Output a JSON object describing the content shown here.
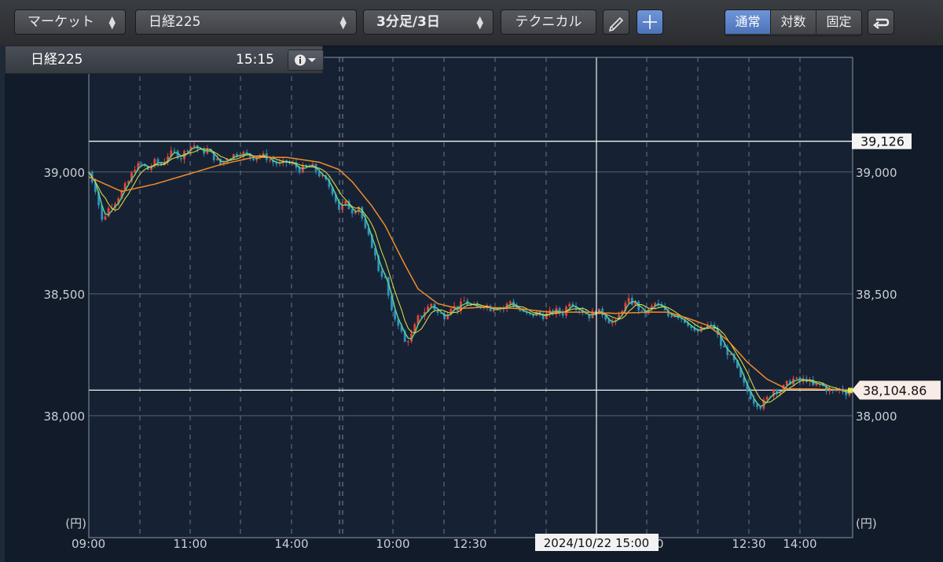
{
  "toolbar": {
    "market_label": "マーケット",
    "symbol_label": "日経225",
    "period_label": "3分足/3日",
    "technical_label": "テクニカル",
    "scale_options": [
      "通常",
      "対数",
      "固定"
    ],
    "active_scale": "通常",
    "pen_icon": "pencil-icon",
    "crosshair_icon": "plus-icon",
    "undo_icon": "return-arrow-icon"
  },
  "info": {
    "symbol": "日経225",
    "time": "15:15",
    "menu_icon": "info-icon"
  },
  "colors": {
    "background": "#121b29",
    "grid": "#5f6a78",
    "up_candle": "#e8443a",
    "down_candle": "#2f8fc2",
    "ma_short": "#5ad08c",
    "ma_mid": "#e9e34a",
    "ma_long": "#f08c2c",
    "active_button": "#5a82c8"
  },
  "chart_data": {
    "type": "candlestick",
    "unit_label": "(円)",
    "y_ticks": [
      "39,000",
      "38,500",
      "38,000"
    ],
    "ylim": [
      37500,
      39470
    ],
    "x_ticks": [
      "09:00",
      "11:00",
      "14:00",
      "10:00",
      "12:30",
      "15:00",
      "12:30",
      "14:00"
    ],
    "crosshair_label": "2024/10/22 15:00",
    "horizontal_lines": [
      {
        "value": 39126,
        "label": "39,126"
      },
      {
        "value": 38104.86,
        "label": "38,104.86"
      }
    ],
    "price_path": [
      [
        0,
        39000
      ],
      [
        2,
        38930
      ],
      [
        4,
        38800
      ],
      [
        6,
        38850
      ],
      [
        8,
        38880
      ],
      [
        10,
        38920
      ],
      [
        12,
        38960
      ],
      [
        14,
        39020
      ],
      [
        16,
        39030
      ],
      [
        18,
        39010
      ],
      [
        20,
        39040
      ],
      [
        22,
        39030
      ],
      [
        24,
        39070
      ],
      [
        26,
        39080
      ],
      [
        28,
        39060
      ],
      [
        30,
        39100
      ],
      [
        32,
        39110
      ],
      [
        34,
        39080
      ],
      [
        36,
        39090
      ],
      [
        38,
        39060
      ],
      [
        40,
        39030
      ],
      [
        42,
        39060
      ],
      [
        44,
        39070
      ],
      [
        46,
        39080
      ],
      [
        48,
        39070
      ],
      [
        50,
        39060
      ],
      [
        52,
        39070
      ],
      [
        54,
        39060
      ],
      [
        56,
        39040
      ],
      [
        58,
        39030
      ],
      [
        60,
        39040
      ],
      [
        62,
        39030
      ],
      [
        64,
        39010
      ],
      [
        66,
        39020
      ],
      [
        68,
        39020
      ],
      [
        70,
        38990
      ],
      [
        72,
        38960
      ],
      [
        74,
        38920
      ],
      [
        76,
        38850
      ],
      [
        78,
        38870
      ],
      [
        80,
        38840
      ],
      [
        82,
        38860
      ],
      [
        84,
        38760
      ],
      [
        86,
        38700
      ],
      [
        88,
        38600
      ],
      [
        90,
        38560
      ],
      [
        92,
        38420
      ],
      [
        94,
        38380
      ],
      [
        96,
        38300
      ],
      [
        98,
        38330
      ],
      [
        100,
        38400
      ],
      [
        102,
        38430
      ],
      [
        104,
        38460
      ],
      [
        106,
        38420
      ],
      [
        108,
        38410
      ],
      [
        110,
        38450
      ],
      [
        112,
        38440
      ],
      [
        114,
        38470
      ],
      [
        116,
        38450
      ],
      [
        118,
        38440
      ],
      [
        120,
        38460
      ],
      [
        122,
        38440
      ],
      [
        124,
        38450
      ],
      [
        126,
        38440
      ],
      [
        128,
        38470
      ],
      [
        130,
        38440
      ],
      [
        132,
        38420
      ],
      [
        134,
        38410
      ],
      [
        136,
        38420
      ],
      [
        138,
        38410
      ],
      [
        140,
        38420
      ],
      [
        142,
        38430
      ],
      [
        144,
        38420
      ],
      [
        146,
        38470
      ],
      [
        148,
        38450
      ],
      [
        150,
        38430
      ],
      [
        152,
        38410
      ],
      [
        154,
        38430
      ],
      [
        156,
        38420
      ],
      [
        158,
        38390
      ],
      [
        160,
        38380
      ],
      [
        162,
        38440
      ],
      [
        164,
        38470
      ],
      [
        166,
        38460
      ],
      [
        168,
        38420
      ],
      [
        170,
        38430
      ],
      [
        172,
        38460
      ],
      [
        174,
        38440
      ],
      [
        176,
        38410
      ],
      [
        178,
        38420
      ],
      [
        180,
        38400
      ],
      [
        182,
        38380
      ],
      [
        184,
        38340
      ],
      [
        186,
        38350
      ],
      [
        188,
        38370
      ],
      [
        190,
        38360
      ],
      [
        192,
        38290
      ],
      [
        194,
        38260
      ],
      [
        196,
        38220
      ],
      [
        198,
        38150
      ],
      [
        200,
        38100
      ],
      [
        202,
        38060
      ],
      [
        204,
        38040
      ],
      [
        206,
        38070
      ],
      [
        208,
        38110
      ],
      [
        210,
        38100
      ],
      [
        212,
        38130
      ],
      [
        214,
        38150
      ],
      [
        216,
        38140
      ],
      [
        218,
        38150
      ],
      [
        220,
        38120
      ],
      [
        222,
        38130
      ],
      [
        224,
        38110
      ],
      [
        226,
        38100
      ],
      [
        228,
        38110
      ],
      [
        230,
        38095
      ],
      [
        232,
        38105
      ]
    ],
    "ma_long_path": [
      [
        0,
        38980
      ],
      [
        10,
        38920
      ],
      [
        20,
        38950
      ],
      [
        30,
        38990
      ],
      [
        40,
        39030
      ],
      [
        50,
        39060
      ],
      [
        60,
        39060
      ],
      [
        70,
        39040
      ],
      [
        76,
        39010
      ],
      [
        80,
        38960
      ],
      [
        86,
        38860
      ],
      [
        90,
        38780
      ],
      [
        96,
        38620
      ],
      [
        100,
        38520
      ],
      [
        106,
        38460
      ],
      [
        112,
        38440
      ],
      [
        120,
        38445
      ],
      [
        130,
        38440
      ],
      [
        140,
        38425
      ],
      [
        150,
        38425
      ],
      [
        160,
        38420
      ],
      [
        170,
        38425
      ],
      [
        176,
        38425
      ],
      [
        182,
        38400
      ],
      [
        188,
        38370
      ],
      [
        194,
        38310
      ],
      [
        200,
        38220
      ],
      [
        206,
        38150
      ],
      [
        212,
        38110
      ],
      [
        220,
        38110
      ],
      [
        232,
        38105
      ]
    ]
  }
}
